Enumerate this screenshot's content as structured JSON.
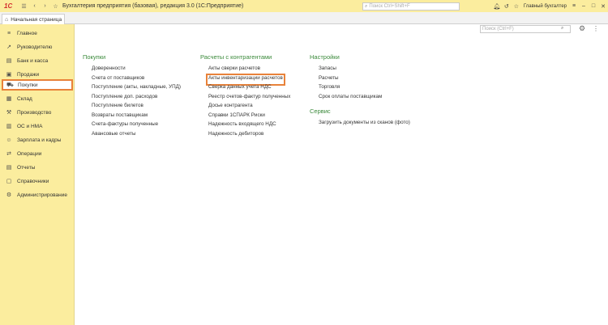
{
  "titlebar": {
    "logo": "1С",
    "title": "Бухгалтерия предприятия (базовая), редакция 3.0  (1С:Предприятие)",
    "search_placeholder": "Поиск Ctrl+Shift+F",
    "user": "Главный бухгалтер"
  },
  "tabs": [
    {
      "label": "Начальная страница"
    }
  ],
  "sidebar": {
    "items": [
      {
        "label": "Главное",
        "icon": "hamburger-icon"
      },
      {
        "label": "Руководителю",
        "icon": "chart-line-icon"
      },
      {
        "label": "Банк и касса",
        "icon": "bank-icon"
      },
      {
        "label": "Продажи",
        "icon": "bag-icon"
      },
      {
        "label": "Покупки",
        "icon": "cart-icon",
        "active": true
      },
      {
        "label": "Склад",
        "icon": "warehouse-icon"
      },
      {
        "label": "Производство",
        "icon": "factory-icon"
      },
      {
        "label": "ОС и НМА",
        "icon": "building-icon"
      },
      {
        "label": "Зарплата и кадры",
        "icon": "people-icon"
      },
      {
        "label": "Операции",
        "icon": "operations-icon"
      },
      {
        "label": "Отчеты",
        "icon": "report-icon"
      },
      {
        "label": "Справочники",
        "icon": "book-icon"
      },
      {
        "label": "Администрирование",
        "icon": "gear-icon"
      }
    ]
  },
  "main": {
    "search_placeholder": "Поиск (Ctrl+F)",
    "columns": [
      {
        "title": "Покупки",
        "links": [
          "Доверенности",
          "Счета от поставщиков",
          "Поступление (акты, накладные, УПД)",
          "Поступление доп. расходов",
          "Поступление билетов",
          "Возвраты поставщикам",
          "Счета-фактуры полученные",
          "Авансовые отчеты"
        ]
      },
      {
        "title": "Расчеты с контрагентами",
        "links": [
          "Акты сверки расчетов",
          "Акты инвентаризации расчетов",
          "Сверка данных учета НДС",
          "Реестр счетов-фактур полученных",
          "Досье контрагента",
          "Справки 1СПАРК Риски",
          "Надежность входящего НДС",
          "Надежность дебиторов"
        ]
      },
      {
        "title": "Настройки",
        "links": [
          "Запасы",
          "Расчеты",
          "Торговля",
          "Срок оплаты поставщикам"
        ],
        "section2_title": "Сервис",
        "section2_links": [
          "Загрузить документы из сканов (фото)"
        ]
      }
    ]
  },
  "colors": {
    "sidebar_bg": "#fbed9e",
    "section_title": "#3b8a3b",
    "highlight": "#e8823a"
  }
}
